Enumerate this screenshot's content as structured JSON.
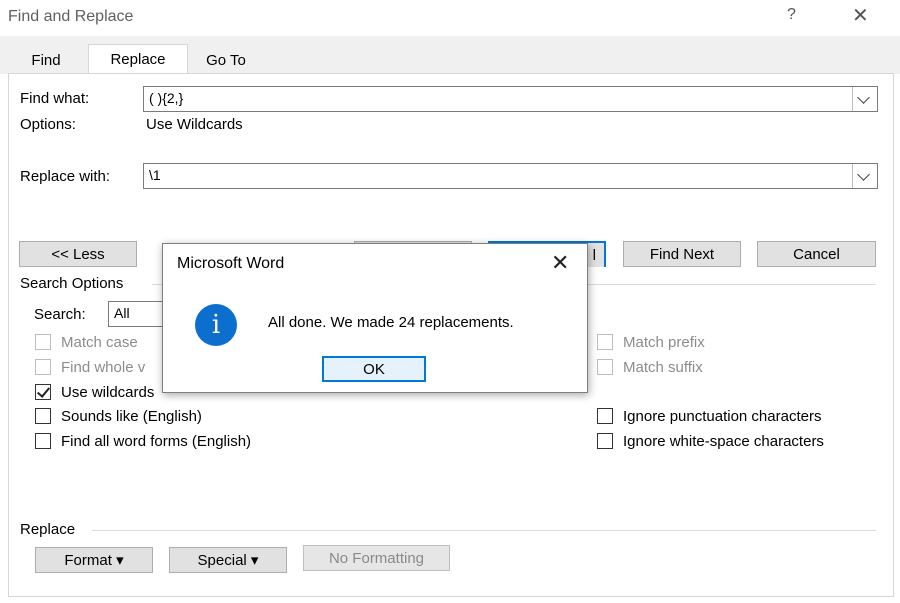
{
  "window": {
    "title": "Find and Replace",
    "help_icon": "?",
    "close_icon": "✕"
  },
  "tabs": [
    {
      "label": "Find",
      "u": "F"
    },
    {
      "label": "Replace",
      "u": "p"
    },
    {
      "label": "Go To",
      "u": "G"
    }
  ],
  "find": {
    "label": "Find what:",
    "value": "( ){2,}"
  },
  "options": {
    "label": "Options:",
    "value": "Use Wildcards"
  },
  "replace": {
    "label": "Replace with:",
    "value": "\\1"
  },
  "buttons": {
    "less": "<< Less",
    "find_next": "Find Next",
    "cancel": "Cancel",
    "hidden_partial": "l"
  },
  "search_options": {
    "heading": "Search Options",
    "search_label": "Search:",
    "search_value": "All"
  },
  "checkboxes": {
    "match_case": "Match case",
    "find_whole": "Find whole v",
    "use_wildcards": "Use wildcards",
    "sounds_like": "Sounds like (English)",
    "all_word_forms": "Find all word forms (English)",
    "match_prefix": "Match prefix",
    "match_suffix": "Match suffix",
    "ignore_punct": "Ignore punctuation characters",
    "ignore_ws": "Ignore white-space characters"
  },
  "replace_section": {
    "heading": "Replace",
    "format": "Format ▾",
    "special": "Special ▾",
    "no_formatting": "No Formatting"
  },
  "popup": {
    "title": "Microsoft Word",
    "close": "✕",
    "icon_glyph": "i",
    "message": "All done. We made 24 replacements.",
    "ok": "OK"
  },
  "colors": {
    "accent": "#0078d7",
    "info_icon": "#0d6fcd"
  }
}
